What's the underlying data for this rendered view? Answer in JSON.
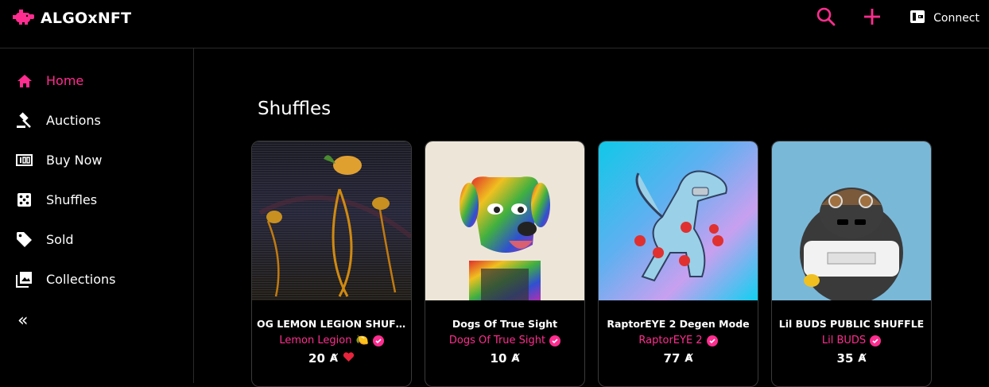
{
  "app": {
    "brand": "ALGOxNFT",
    "accent": "#ff2d8f"
  },
  "header": {
    "search_icon": "search-icon",
    "add_icon": "plus-icon",
    "connect_label": "Connect",
    "wallet_icon": "wallet-icon"
  },
  "sidebar": {
    "items": [
      {
        "label": "Home",
        "icon": "home-icon",
        "active": true
      },
      {
        "label": "Auctions",
        "icon": "gavel-icon",
        "active": false
      },
      {
        "label": "Buy Now",
        "icon": "receipt-icon",
        "active": false
      },
      {
        "label": "Shuffles",
        "icon": "dice-icon",
        "active": false
      },
      {
        "label": "Sold",
        "icon": "tag-icon",
        "active": false
      },
      {
        "label": "Collections",
        "icon": "collection-icon",
        "active": false
      }
    ],
    "collapse_label": "«"
  },
  "main": {
    "section_title": "Shuffles",
    "cards": [
      {
        "title": "OG LEMON LEGION SHUFF...",
        "creator": "Lemon Legion",
        "creator_emoji": "🍋",
        "price": "20",
        "currency": "Ⱥ",
        "liked": true
      },
      {
        "title": "Dogs Of True Sight",
        "creator": "Dogs Of True Sight",
        "price": "10",
        "currency": "Ⱥ",
        "liked": false
      },
      {
        "title": "RaptorEYE 2 Degen Mode",
        "creator": "RaptorEYE 2",
        "price": "77",
        "currency": "Ⱥ",
        "liked": false
      },
      {
        "title": "Lil BUDS PUBLIC SHUFFLE",
        "creator": "Lil BUDS",
        "price": "35",
        "currency": "Ⱥ",
        "liked": false
      }
    ]
  }
}
